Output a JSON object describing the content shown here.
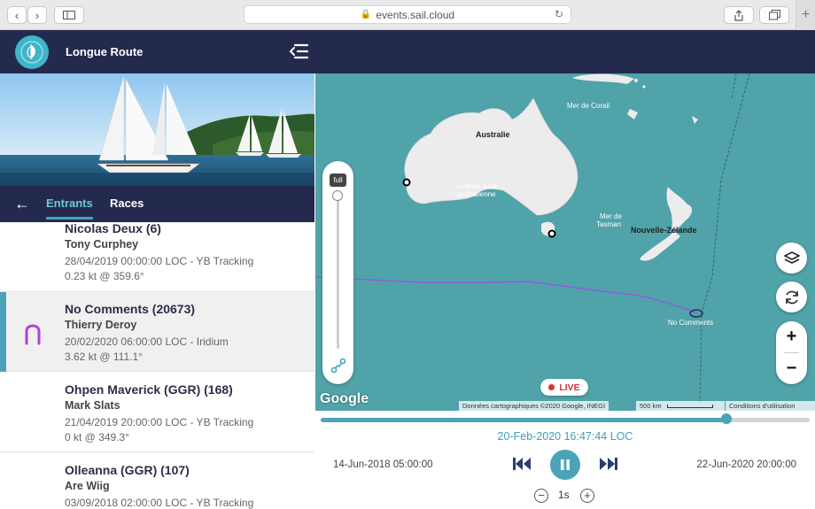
{
  "browser": {
    "url": "events.sail.cloud",
    "new_tab": "+"
  },
  "app": {
    "title": "Longue Route"
  },
  "tabs": {
    "back": "←",
    "entrants": "Entrants",
    "races": "Races"
  },
  "entrants": [
    {
      "name": "Nicolas Deux (6)",
      "skipper": "Tony Curphey",
      "time": "28/04/2019 00:00:00 LOC - YB Tracking",
      "speed": "0.23 kt @ 359.6°"
    },
    {
      "name": "No Comments (20673)",
      "skipper": "Thierry Deroy",
      "time": "20/02/2020 06:00:00 LOC - Iridium",
      "speed": "3.62 kt @ 111.1°",
      "selected": true,
      "color": "#b03fe0"
    },
    {
      "name": "Ohpen Maverick (GGR) (168)",
      "skipper": "Mark Slats",
      "time": "21/04/2019 20:00:00 LOC - YB Tracking",
      "speed": "0 kt @ 349.3°"
    },
    {
      "name": "Olleanna (GGR) (107)",
      "skipper": "Are Wiig",
      "time": "03/09/2018 02:00:00 LOC - YB Tracking",
      "speed": ""
    }
  ],
  "map": {
    "labels": {
      "coral": "Mer de Corail",
      "australia": "Australie",
      "bight": "Grande Baie",
      "bight2": "australienne",
      "tasman1": "Mer de",
      "tasman2": "Tasman",
      "nz": "Nouvelle-Zélande",
      "boat": "No Comments"
    },
    "full_label": "full",
    "google": "Google",
    "attribution": "Données cartographiques ©2020 Google, INEGI",
    "scale": "500 km",
    "terms": "Conditions d'utilisation",
    "live": "LIVE",
    "track_color": "#a04de6"
  },
  "timeline": {
    "current": "20-Feb-2020 16:47:44 LOC",
    "start": "14-Jun-2018 05:00:00",
    "end": "22-Jun-2020 20:00:00",
    "speed": "1s",
    "progress": 0.83
  }
}
